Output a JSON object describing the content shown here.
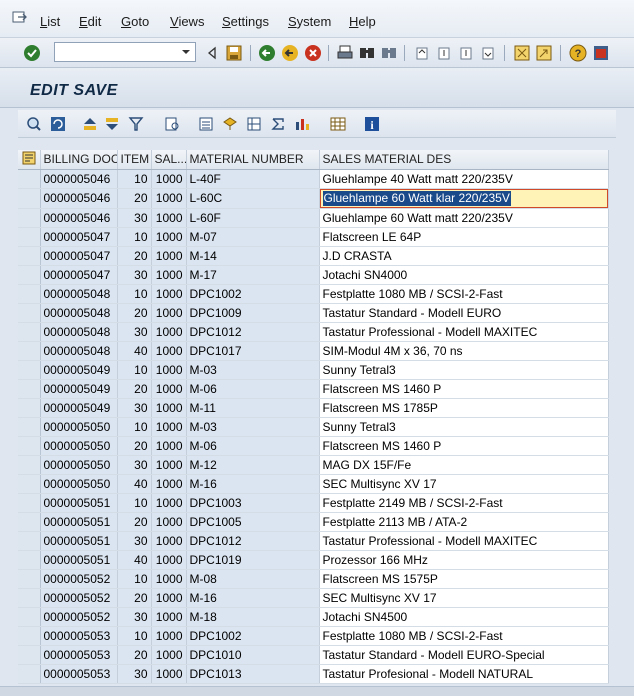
{
  "menu": {
    "items": [
      {
        "label": "List",
        "u": "L",
        "rest": "ist"
      },
      {
        "label": "Edit",
        "u": "E",
        "rest": "dit"
      },
      {
        "label": "Goto",
        "u": "G",
        "rest": "oto"
      },
      {
        "label": "Views",
        "u": "V",
        "rest": "iews"
      },
      {
        "label": "Settings",
        "u": "S",
        "rest": "ettings"
      },
      {
        "label": "System",
        "u": "S",
        "rest": "ystem"
      },
      {
        "label": "Help",
        "u": "H",
        "rest": "elp"
      }
    ]
  },
  "toolbar": {
    "command_value": ""
  },
  "title": "EDIT SAVE",
  "grid": {
    "columns": [
      "BILLING DOC",
      "ITEM",
      "SAL...",
      "MATERIAL NUMBER",
      "SALES MATERIAL DES"
    ],
    "rows": [
      [
        "0000005046",
        "10",
        "1000",
        "L-40F",
        "Gluehlampe 40 Watt matt 220/235V"
      ],
      [
        "0000005046",
        "20",
        "1000",
        "L-60C",
        "Gluehlampe 60 Watt klar 220/235V"
      ],
      [
        "0000005046",
        "30",
        "1000",
        "L-60F",
        "Gluehlampe 60 Watt matt 220/235V"
      ],
      [
        "0000005047",
        "10",
        "1000",
        "M-07",
        "Flatscreen LE 64P"
      ],
      [
        "0000005047",
        "20",
        "1000",
        "M-14",
        "J.D CRASTA"
      ],
      [
        "0000005047",
        "30",
        "1000",
        "M-17",
        "Jotachi SN4000"
      ],
      [
        "0000005048",
        "10",
        "1000",
        "DPC1002",
        "Festplatte 1080 MB / SCSI-2-Fast"
      ],
      [
        "0000005048",
        "20",
        "1000",
        "DPC1009",
        "Tastatur Standard - Modell EURO"
      ],
      [
        "0000005048",
        "30",
        "1000",
        "DPC1012",
        "Tastatur Professional - Modell MAXITEC"
      ],
      [
        "0000005048",
        "40",
        "1000",
        "DPC1017",
        "SIM-Modul 4M x 36, 70 ns"
      ],
      [
        "0000005049",
        "10",
        "1000",
        "M-03",
        "Sunny Tetral3"
      ],
      [
        "0000005049",
        "20",
        "1000",
        "M-06",
        "Flatscreen MS 1460 P"
      ],
      [
        "0000005049",
        "30",
        "1000",
        "M-11",
        "Flatscreen MS 1785P"
      ],
      [
        "0000005050",
        "10",
        "1000",
        "M-03",
        "Sunny Tetral3"
      ],
      [
        "0000005050",
        "20",
        "1000",
        "M-06",
        "Flatscreen MS 1460 P"
      ],
      [
        "0000005050",
        "30",
        "1000",
        "M-12",
        "MAG DX 15F/Fe"
      ],
      [
        "0000005050",
        "40",
        "1000",
        "M-16",
        "SEC Multisync XV 17"
      ],
      [
        "0000005051",
        "10",
        "1000",
        "DPC1003",
        "Festplatte 2149 MB / SCSI-2-Fast"
      ],
      [
        "0000005051",
        "20",
        "1000",
        "DPC1005",
        "Festplatte 2113 MB /  ATA-2"
      ],
      [
        "0000005051",
        "30",
        "1000",
        "DPC1012",
        "Tastatur Professional - Modell MAXITEC"
      ],
      [
        "0000005051",
        "40",
        "1000",
        "DPC1019",
        "Prozessor 166 MHz"
      ],
      [
        "0000005052",
        "10",
        "1000",
        "M-08",
        "Flatscreen MS 1575P"
      ],
      [
        "0000005052",
        "20",
        "1000",
        "M-16",
        "SEC Multisync XV 17"
      ],
      [
        "0000005052",
        "30",
        "1000",
        "M-18",
        "Jotachi SN4500"
      ],
      [
        "0000005053",
        "10",
        "1000",
        "DPC1002",
        "Festplatte 1080 MB / SCSI-2-Fast"
      ],
      [
        "0000005053",
        "20",
        "1000",
        "DPC1010",
        "Tastatur Standard - Modell EURO-Special"
      ],
      [
        "0000005053",
        "30",
        "1000",
        "DPC1013",
        "Tastatur Profesional - Modell NATURAL"
      ]
    ],
    "focused_row": 1
  },
  "colors": {
    "key_col": "#dbe5f1",
    "focus_bg": "#fff3b8",
    "selection_text_bg": "#1b4a8a"
  }
}
